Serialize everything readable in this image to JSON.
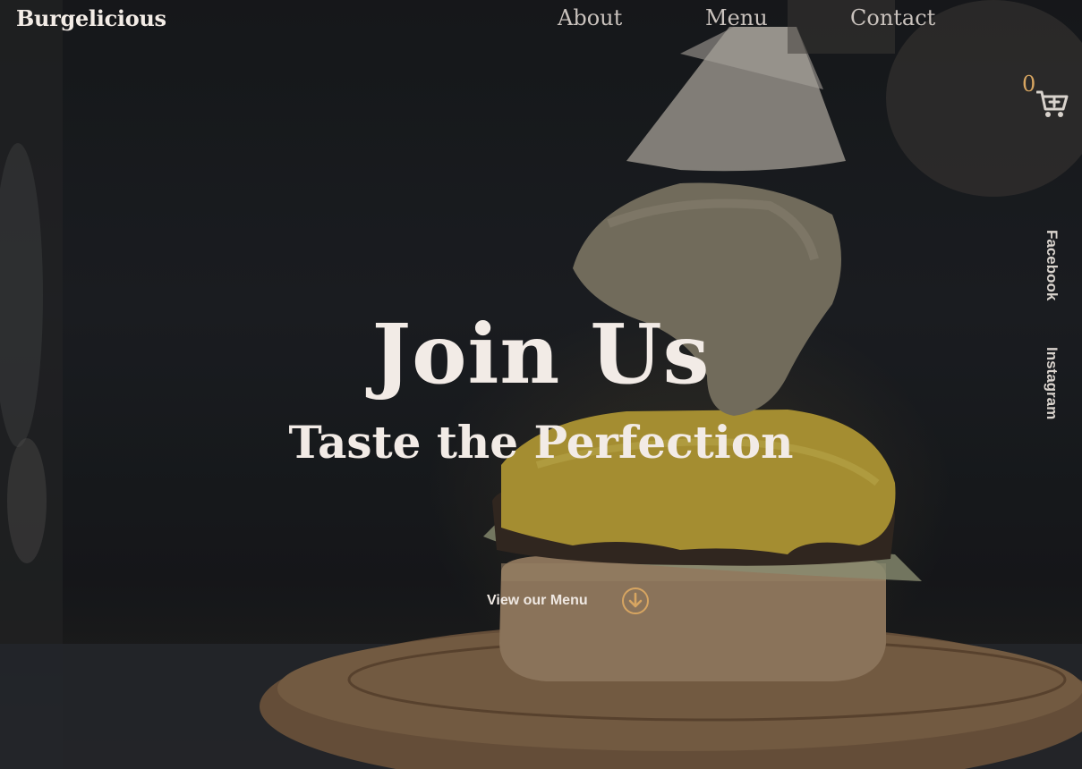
{
  "header": {
    "logo": "Burgelicious",
    "nav": [
      {
        "label": "About"
      },
      {
        "label": "Menu"
      },
      {
        "label": "Contact"
      }
    ]
  },
  "cart": {
    "count": "0",
    "icon": "cart-plus-icon"
  },
  "social": [
    {
      "label": "Facebook"
    },
    {
      "label": "Instagram"
    }
  ],
  "hero": {
    "title": "Join Us",
    "subtitle": "Taste the Perfection",
    "cta_label": "View our Menu",
    "cta_icon": "arrow-down-circle-icon"
  },
  "colors": {
    "accent": "#d7a561",
    "text_light": "#f2ebe6",
    "nav_text": "#c9c2bd"
  }
}
